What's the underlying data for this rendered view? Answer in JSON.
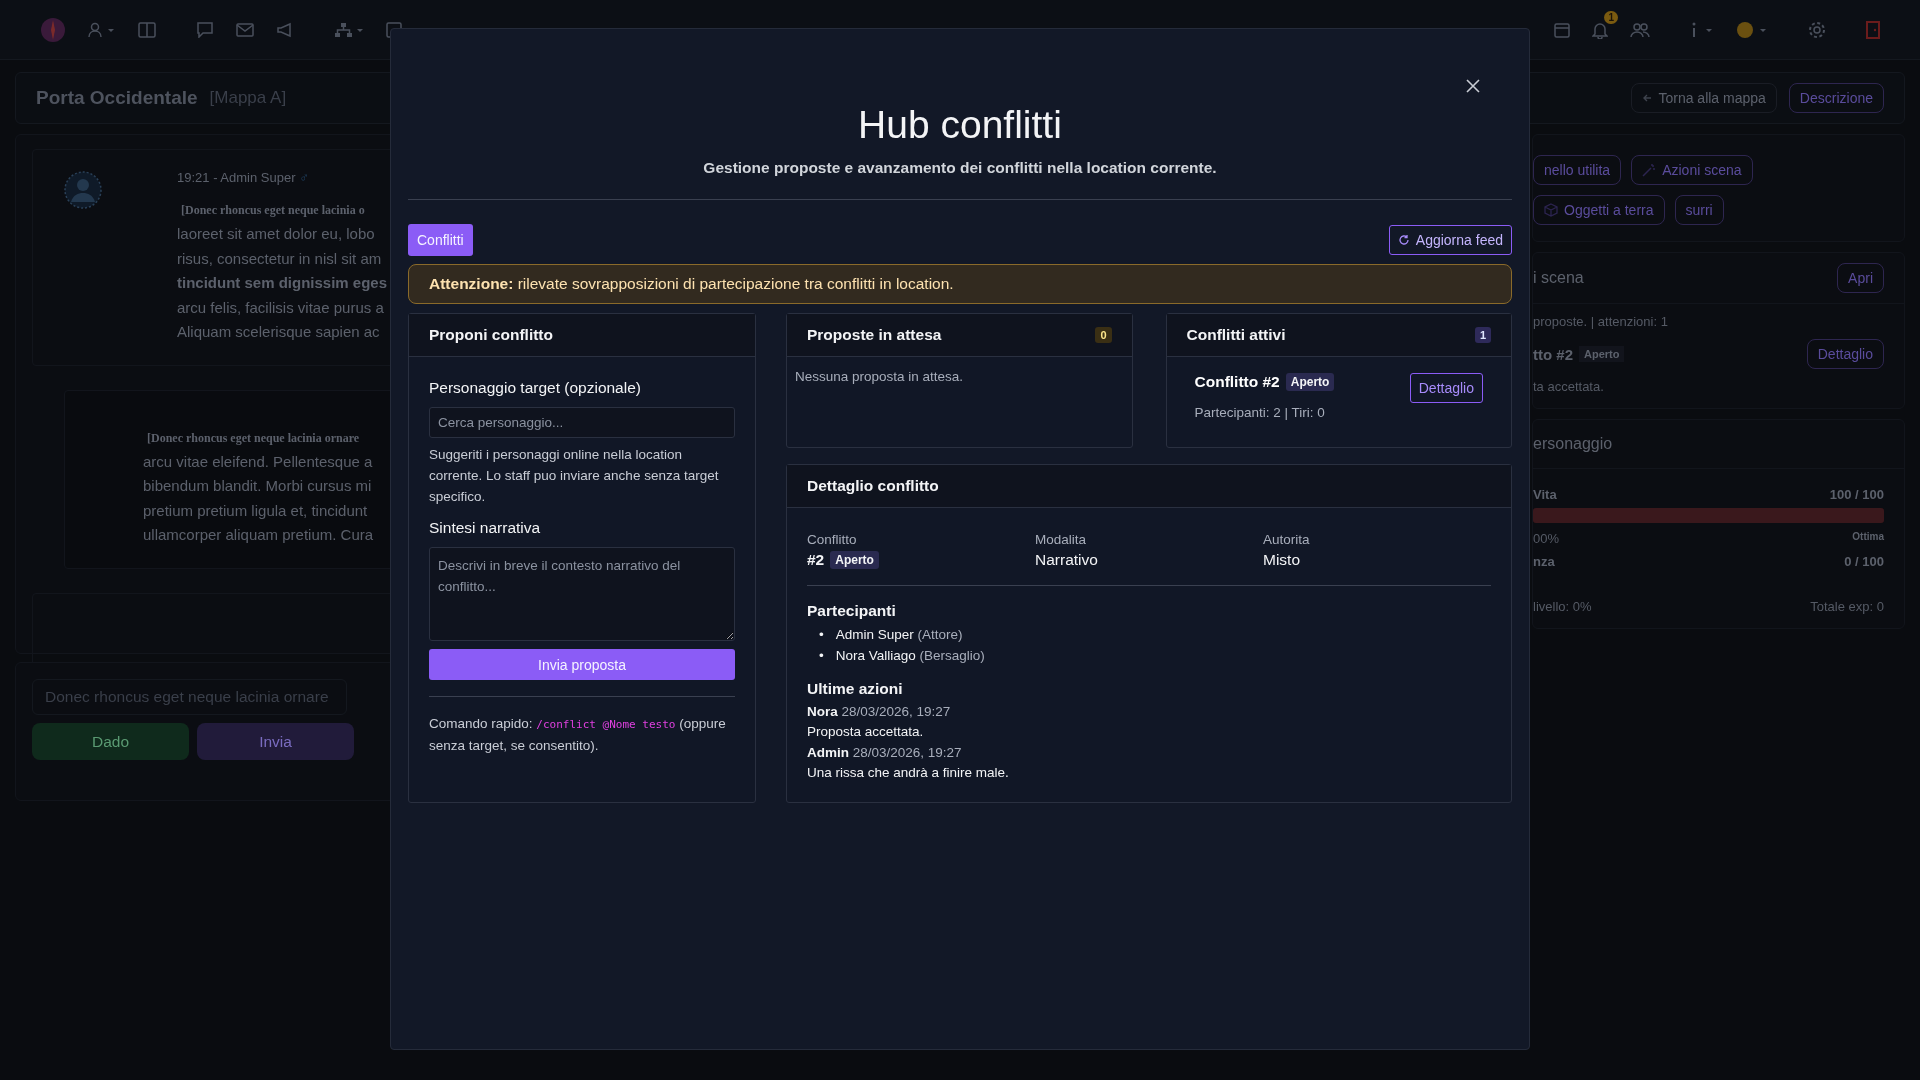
{
  "topbar": {
    "notification_count": "1"
  },
  "location": {
    "title": "Porta Occidentale",
    "map": "[Mappa A]",
    "back_button": "Torna alla mappa",
    "description_button": "Descrizione"
  },
  "chat": {
    "messages": [
      {
        "meta": "19:21 - Admin Super",
        "gender": "♂",
        "heading": "[Donec rhoncus eget neque lacinia o",
        "lines": [
          {
            "text": "laoreet sit amet dolor eu, lobo",
            "bold": false
          },
          {
            "text": "risus, consectetur in nisl sit am",
            "bold": false
          },
          {
            "text": "tincidunt sem dignissim eges",
            "bold": true
          },
          {
            "text": "arcu felis, facilisis vitae purus a",
            "bold": false
          },
          {
            "text": "Aliquam scelerisque sapien ac",
            "bold": false
          }
        ]
      },
      {
        "heading": "[Donec rhoncus eget neque lacinia ornare",
        "lines": [
          {
            "text": "arcu vitae eleifend. Pellentesque a",
            "bold": false
          },
          {
            "text": "bibendum blandit. Morbi cursus mi",
            "bold": false
          },
          {
            "text": "pretium pretium ligula et, tincidunt",
            "bold": false
          },
          {
            "text": "ullamcorper aliquam pretium. Cura",
            "bold": false
          }
        ]
      }
    ],
    "input_value": "Donec rhoncus eget neque lacinia ornare",
    "dice_button": "Dado",
    "send_button": "Invia"
  },
  "sidebar": {
    "tools": [
      "nello utilita",
      "Azioni scena",
      "Oggetti a terra",
      "surri"
    ],
    "scene": {
      "title": "i scena",
      "open_button": "Apri",
      "summary": "proposte. | attenzioni: 1",
      "conflict": "tto #2",
      "status": "Aperto",
      "detail_button": "Dettaglio",
      "last": "ta accettata."
    },
    "character": {
      "title": "ersonaggio",
      "stats": [
        {
          "label": "Vita",
          "value": "100 / 100",
          "level": 1,
          "percent": "00%",
          "quality": "Ottima"
        },
        {
          "label": "nza",
          "value": "0 / 100"
        }
      ],
      "level_text": "livello: 0%",
      "exp_text": "Totale exp: 0"
    }
  },
  "modal": {
    "title": "Hub conflitti",
    "subtitle": "Gestione proposte e avanzamento dei conflitti nella location corrente.",
    "tabs": [
      {
        "label": "Conflitti",
        "selected": true
      }
    ],
    "refresh_button": "Aggiorna feed",
    "alert": "**Attenzione:** rilevate sovrapposizioni di partecipazione tra conflitti in location.",
    "propose": {
      "title": "Proponi conflitto",
      "target_label": "Personaggio target (opzionale)",
      "target_placeholder": "Cerca personaggio...",
      "target_help": "Suggeriti i personaggi online nella location corrente. Lo staff puo inviare anche senza target specifico.",
      "summary_label": "Sintesi narrativa",
      "summary_placeholder": "Descrivi in breve il contesto narrativo del conflitto...",
      "submit": "Invia proposta",
      "hint_prefix": "Comando rapido:",
      "hint_code": "/conflict @Nome testo",
      "hint_suffix": "(oppure senza target, se consentito)."
    },
    "pending": {
      "title": "Proposte in attesa",
      "count": "0",
      "empty": "Nessuna proposta in attesa."
    },
    "active": {
      "title": "Conflitti attivi",
      "count": "1",
      "items": [
        {
          "name": "Conflitto #2",
          "status": "Aperto",
          "meta": "Partecipanti: 2 | Tiri: 0",
          "button": "Dettaglio"
        }
      ]
    },
    "detail": {
      "title": "Dettaglio conflitto",
      "fields": [
        {
          "label": "Conflitto",
          "value": "#2",
          "status": "Aperto"
        },
        {
          "label": "Modalita",
          "value": "Narrativo"
        },
        {
          "label": "Autorita",
          "value": "Misto"
        }
      ],
      "participants_title": "Partecipanti",
      "participants": [
        {
          "bullet": "•",
          "name": "Admin Super",
          "role": "(Attore)"
        },
        {
          "bullet": "•",
          "name": "Nora Valliago",
          "role": "(Bersaglio)"
        }
      ],
      "actions_title": "Ultime azioni",
      "actions": [
        {
          "author": "Nora",
          "time": "28/03/2026, 19:27",
          "text": "Proposta accettata."
        },
        {
          "author": "Admin",
          "time": "28/03/2026, 19:27",
          "text": "Una rissa che andrà a finire male."
        }
      ]
    }
  }
}
